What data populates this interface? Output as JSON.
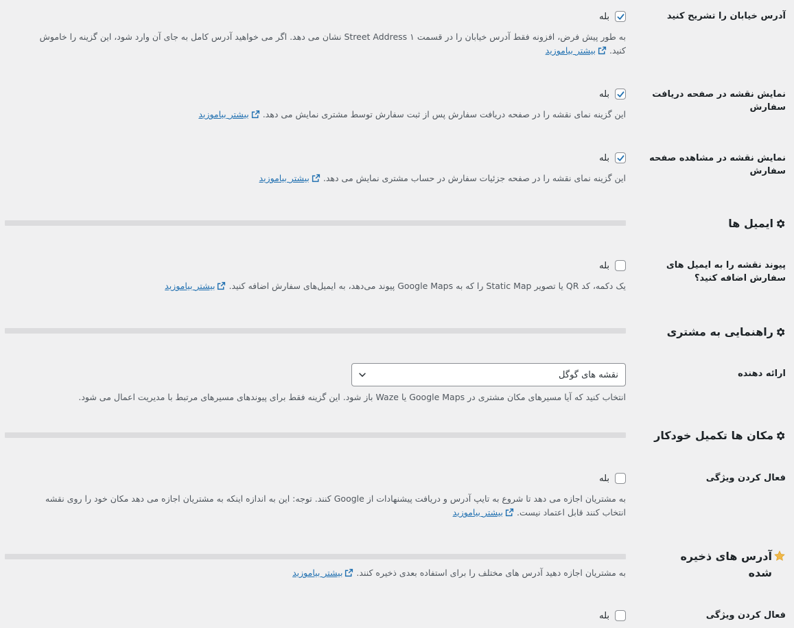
{
  "common": {
    "yes_label": "بله",
    "learn_more": "بیشتر بیاموزید"
  },
  "rows": {
    "street_address": {
      "label": "آدرس خیابان را تشریح کنید",
      "checked": true,
      "desc": "به طور پیش فرض، افزونه فقط آدرس خیابان را در قسمت Street Address ۱ نشان می دهد. اگر می خواهید آدرس کامل به جای آن وارد شود، این گزینه را خاموش کنید."
    },
    "map_thankyou": {
      "label": "نمایش نقشه در صفحه دریافت سفارش",
      "checked": true,
      "desc": "این گزینه نمای نقشه را در صفحه دریافت سفارش پس از ثبت سفارش توسط مشتری نمایش می دهد."
    },
    "map_view_order": {
      "label": "نمایش نقشه در مشاهده صفحه سفارش",
      "checked": true,
      "desc": "این گزینه نمای نقشه را در صفحه جزئیات سفارش در حساب مشتری نمایش می دهد."
    },
    "map_link_emails": {
      "label": "پیوند نقشه را به ایمیل های سفارش اضافه کنید؟",
      "checked": false,
      "desc": "یک دکمه، کد QR یا تصویر Static Map را که به Google Maps پیوند می‌دهد، به ایمیل‌های سفارش اضافه کنید."
    },
    "provider": {
      "label": "ارائه دهنده",
      "selected": "نقشه های گوگل",
      "desc": "انتخاب کنید که آیا مسیرهای مکان مشتری در Google Maps یا Waze باز شود. این گزینه فقط برای پیوندهای مسیرهای مرتبط با مدیریت اعمال می شود."
    },
    "autocomplete_enable": {
      "label": "فعال کردن ویژگی",
      "checked": false,
      "desc": "به مشتریان اجازه می دهد تا شروع به تایپ آدرس و دریافت پیشنهادات از Google کنند. توجه: این به اندازه اینکه به مشتریان اجازه می دهد مکان خود را روی نقشه انتخاب کنند قابل اعتماد نیست."
    },
    "saved_addresses_enable": {
      "label": "فعال کردن ویژگی",
      "checked": false
    }
  },
  "sections": {
    "emails": {
      "title": "ایمیل ها",
      "icon": "gear-icon"
    },
    "directions": {
      "title": "راهنمایی به مشتری",
      "icon": "gear-icon"
    },
    "autocomplete": {
      "title": "مکان ها تکمیل خودکار",
      "icon": "gear-icon"
    },
    "saved_addresses": {
      "title": "آدرس های ذخیره شده",
      "icon": "star-icon",
      "desc": "به مشتریان اجازه دهید آدرس های مختلف را برای استفاده بعدی ذخیره کنند."
    }
  },
  "colors": {
    "link": "#2271b1",
    "star": "#f0b849",
    "divider": "#dcdcde",
    "background": "#f0f0f1"
  }
}
